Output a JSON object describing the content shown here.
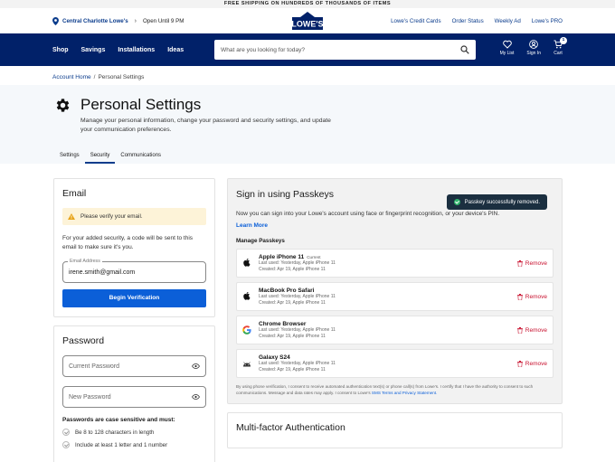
{
  "promo": "FREE SHIPPING ON HUNDREDS OF THOUSANDS OF ITEMS",
  "store": {
    "name": "Central Charlotte Lowe's",
    "hours": "Open Until 9 PM"
  },
  "brand": {
    "logo_text": "LOWE'S",
    "color": "#012169"
  },
  "util_links": [
    "Lowe's Credit Cards",
    "Order Status",
    "Weekly Ad",
    "Lowe's PRO"
  ],
  "nav": {
    "links": [
      "Shop",
      "Savings",
      "Installations",
      "Ideas"
    ],
    "search_placeholder": "What are you looking for today?",
    "icons": [
      {
        "label": "My List",
        "icon": "heart-icon"
      },
      {
        "label": "Sign In",
        "icon": "user-icon"
      },
      {
        "label": "Cart",
        "icon": "cart-icon",
        "badge": "1"
      }
    ]
  },
  "breadcrumb": {
    "home": "Account Home",
    "separator": "/",
    "current": "Personal Settings"
  },
  "header": {
    "title": "Personal Settings",
    "description": "Manage your personal information, change your password and security settings, and update your communication preferences."
  },
  "tabs": [
    {
      "label": "Settings",
      "active": false
    },
    {
      "label": "Security",
      "active": true
    },
    {
      "label": "Communications",
      "active": false
    }
  ],
  "email_card": {
    "title": "Email",
    "warning": "Please verify your email.",
    "paragraph": "For your added security, a code will be sent to this email to make sure it's you.",
    "field_label": "Email Address",
    "field_value": "irene.smith@gmail.com",
    "button": "Begin Verification"
  },
  "password_card": {
    "title": "Password",
    "current_placeholder": "Current Password",
    "new_placeholder": "New Password",
    "rules_title": "Passwords are case sensitive and must:",
    "rules": [
      "Be 8 to 128 characters in length",
      "Include at least 1 letter and 1 number"
    ]
  },
  "passkeys": {
    "title": "Sign in using Passkeys",
    "toast": "Passkey successfully removed.",
    "intro": "Now you can sign into your Lowe's account using face or fingerprint recognition, or your device's PIN.",
    "learn_more": "Learn More",
    "manage_label": "Manage Passkeys",
    "remove_label": "Remove",
    "devices": [
      {
        "name": "Apple iPhone 11",
        "tag": "Current",
        "icon": "apple-icon",
        "last_used": "Last used: Yesterday, Apple iPhone 11",
        "created": "Created: Apr 19, Apple iPhone 11"
      },
      {
        "name": "MacBook Pro Safari",
        "tag": "",
        "icon": "apple-icon",
        "last_used": "Last used: Yesterday, Apple iPhone 11",
        "created": "Created: Apr 19, Apple iPhone 11"
      },
      {
        "name": "Chrome Browser",
        "tag": "",
        "icon": "google-icon",
        "last_used": "Last used: Yesterday, Apple iPhone 11",
        "created": "Created: Apr 19, Apple iPhone 11"
      },
      {
        "name": "Galaxy S24",
        "tag": "",
        "icon": "android-icon",
        "last_used": "Last used: Yesterday, Apple iPhone 11",
        "created": "Created: Apr 19, Apple iPhone 11"
      }
    ],
    "consent": "By using phone verification, I consent to receive automated authentication text(s) or phone call(s) from Lowe's. I certify that I have the authority to consent to such communications. Message and data rates may apply. I consent to Lowe's",
    "consent_link": "SMS Terms and Privacy Statement."
  },
  "mfa": {
    "title": "Multi-factor Authentication"
  }
}
